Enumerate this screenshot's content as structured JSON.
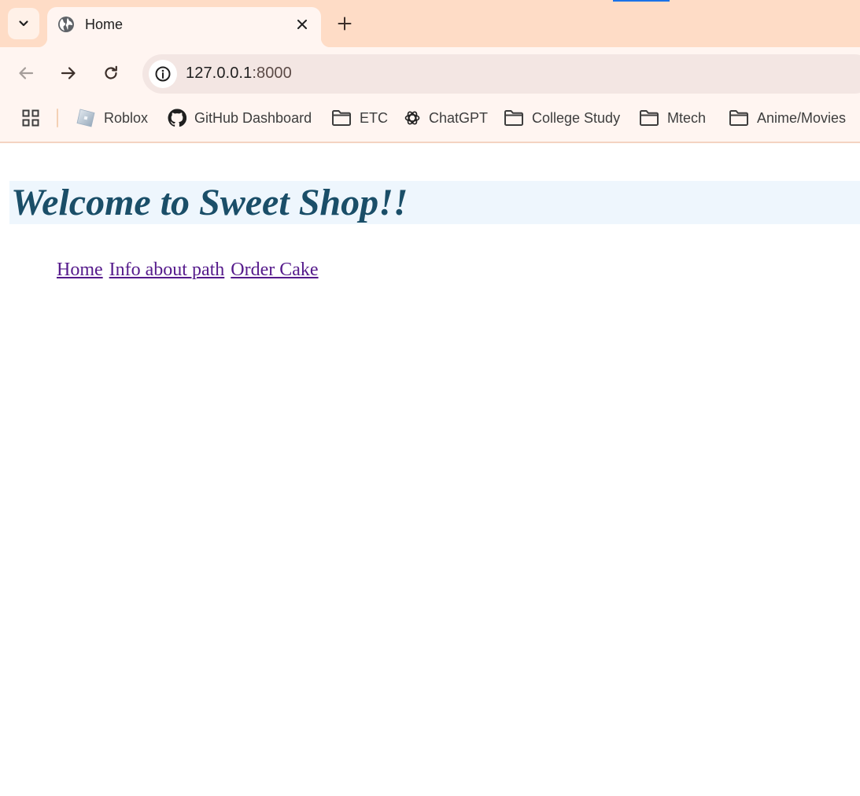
{
  "browser": {
    "tab": {
      "title": "Home"
    },
    "address_bar": {
      "host": "127.0.0.1",
      "port": ":8000"
    },
    "bookmarks": [
      {
        "label": "Roblox",
        "icon": "roblox-icon"
      },
      {
        "label": "GitHub Dashboard",
        "icon": "github-icon"
      },
      {
        "label": "ETC",
        "icon": "folder-icon"
      },
      {
        "label": "ChatGPT",
        "icon": "chatgpt-icon"
      },
      {
        "label": "College Study",
        "icon": "folder-icon"
      },
      {
        "label": "Mtech",
        "icon": "folder-icon"
      },
      {
        "label": "Anime/Movies",
        "icon": "folder-icon"
      }
    ],
    "colors": {
      "tabstrip": "#fedcc6",
      "toolbar": "#fff5f1",
      "omnibox": "#f3e6e3"
    }
  },
  "page": {
    "heading": "Welcome to Sweet Shop!!",
    "nav_links": [
      "Home",
      "Info about path",
      "Order Cake"
    ],
    "colors": {
      "heading_text": "#1a4e68",
      "heading_bg": "#eef6fd",
      "link": "#551a8b"
    }
  }
}
